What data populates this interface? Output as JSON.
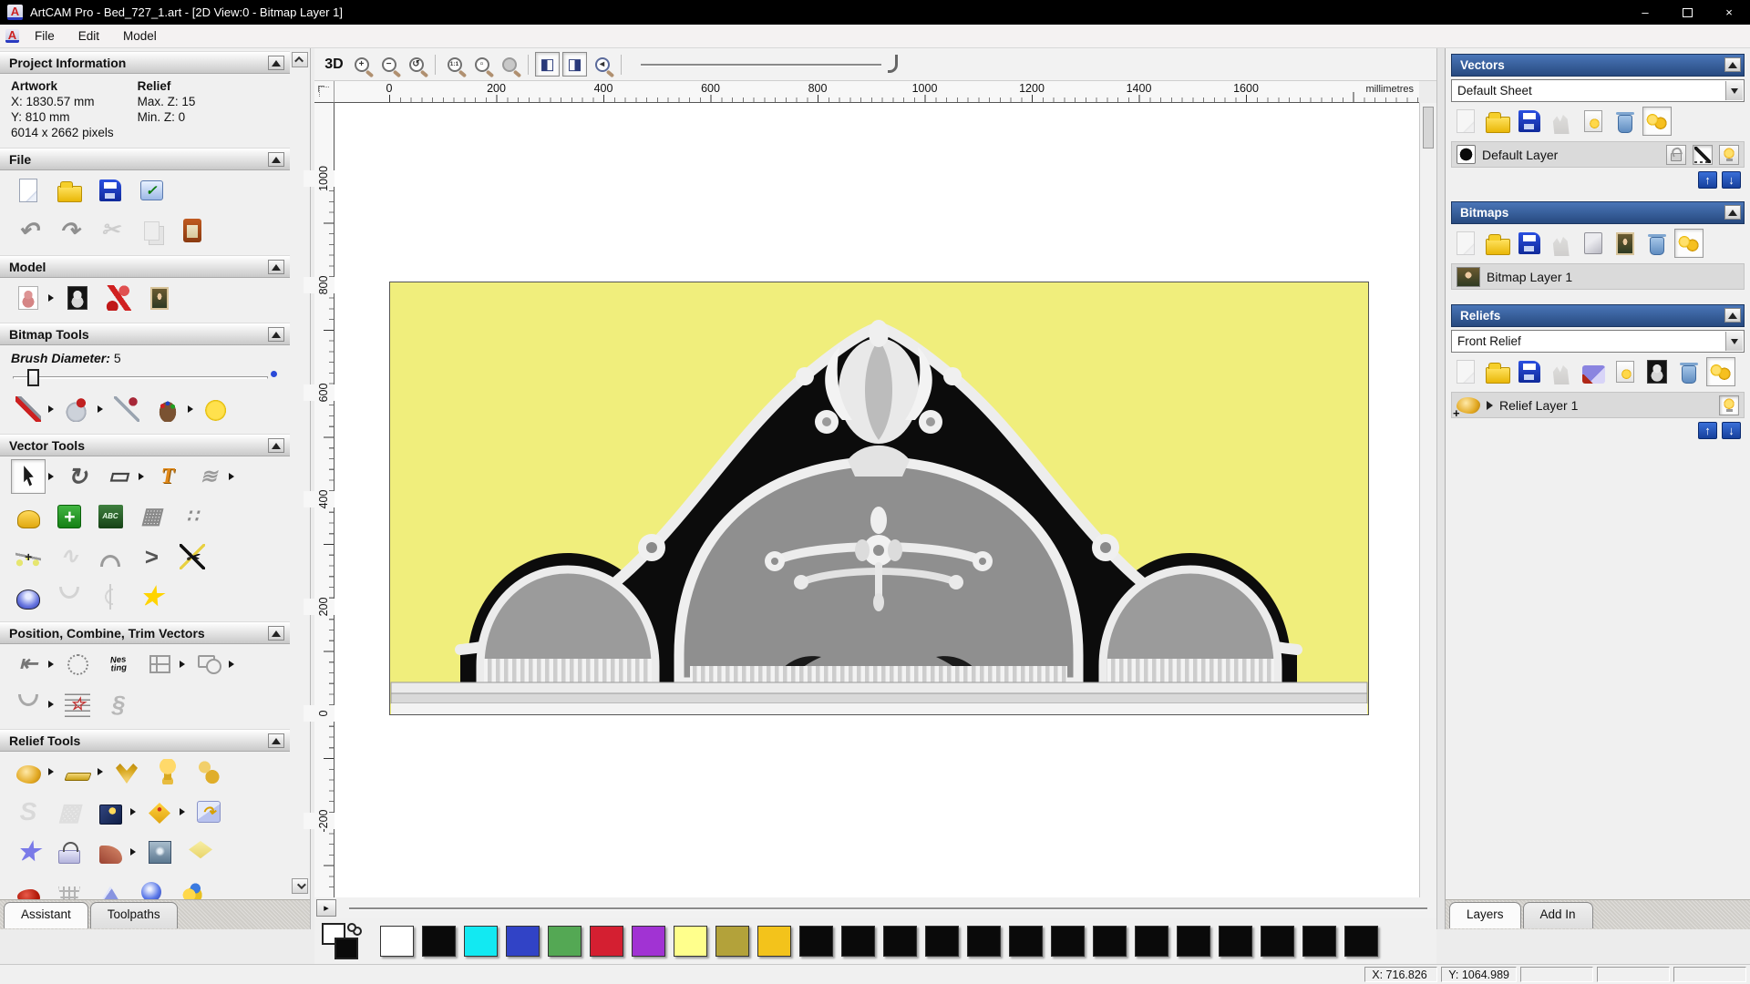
{
  "window": {
    "title": "ArtCAM Pro - Bed_727_1.art - [2D View:0 - Bitmap Layer 1]",
    "minimize": "–",
    "close": "×"
  },
  "menus": [
    "File",
    "Edit",
    "Model"
  ],
  "assistant": {
    "project": {
      "title": "Project Information",
      "artwork": "Artwork",
      "relief": "Relief",
      "x": "X: 1830.57 mm",
      "y": "Y: 810 mm",
      "pixels": "6014 x 2662 pixels",
      "maxz": "Max. Z: 15",
      "minz": "Min. Z: 0"
    },
    "file_title": "File",
    "model_title": "Model",
    "bitmap_title": "Bitmap Tools",
    "vector_title": "Vector Tools",
    "position_title": "Position, Combine, Trim Vectors",
    "relief_title": "Relief Tools",
    "brush_label": "Brush Diameter:",
    "brush_value": "5",
    "tabs": [
      {
        "label": "Assistant"
      },
      {
        "label": "Toolpaths"
      }
    ]
  },
  "toolsets": {
    "file1": [
      {
        "n": "new-model",
        "k": "page"
      },
      {
        "n": "open-model",
        "k": "folder"
      },
      {
        "n": "save-model",
        "k": "floppy"
      },
      {
        "n": "model-options",
        "k": "screen",
        "g": "✓"
      }
    ],
    "file2": [
      {
        "n": "undo",
        "g": "↶",
        "c": "#8f8f8f",
        "fs": 26
      },
      {
        "n": "redo",
        "g": "↷",
        "c": "#8f8f8f",
        "fs": 26
      },
      {
        "n": "cut",
        "g": "✂",
        "c": "#9a9a9a",
        "fs": 24,
        "dis": 1
      },
      {
        "n": "copy",
        "k": "copy",
        "dis": 1
      },
      {
        "n": "paste",
        "k": "clip"
      }
    ],
    "model": [
      {
        "n": "set-model-size",
        "k": "teddy",
        "fly": 1
      },
      {
        "n": "greyscale-model",
        "k": "teddyd"
      },
      {
        "n": "model-lighting",
        "k": "lamp"
      },
      {
        "n": "load-bitmap-image",
        "k": "mona"
      }
    ],
    "bitmap": [
      {
        "n": "paint-bitmap",
        "k": "brush",
        "fly": 1
      },
      {
        "n": "flood-fill",
        "k": "bucket",
        "fly": 1
      },
      {
        "n": "pick-colour",
        "k": "dropper"
      },
      {
        "n": "colour-palette",
        "k": "palette",
        "fly": 1
      },
      {
        "n": "texture-paint",
        "k": "blob"
      }
    ],
    "vector1": [
      {
        "n": "select-vectors",
        "k": "cursor",
        "act": 1,
        "fly": 1
      },
      {
        "n": "transform-vectors",
        "g": "↻",
        "c": "#555",
        "fs": 26
      },
      {
        "n": "create-rectangle",
        "g": "▭",
        "c": "#444",
        "fs": 24,
        "fly": 1
      },
      {
        "n": "create-text",
        "k": "textT",
        "g": "T"
      },
      {
        "n": "envelope-distortion",
        "g": "≋",
        "c": "#9a9a9a",
        "fs": 22,
        "fly": 1
      }
    ],
    "vector2": [
      {
        "n": "measure-tool",
        "k": "measure"
      },
      {
        "n": "add-vector-node",
        "k": "cross",
        "g": "+"
      },
      {
        "n": "text-block",
        "k": "abc",
        "g": "ABC"
      },
      {
        "n": "envelope-mesh",
        "g": "▦",
        "c": "#8a8a8a",
        "fs": 24
      },
      {
        "n": "paste-along-curve",
        "g": "∷",
        "c": "#8a8a8a",
        "fs": 20
      }
    ],
    "vector3": [
      {
        "n": "node-editing",
        "k": "poly",
        "g": "+"
      },
      {
        "n": "freehand-sketch",
        "g": "∿",
        "c": "#b0b0b0",
        "fs": 24,
        "dis": 1
      },
      {
        "n": "fit-arcs-to-vector",
        "k": "arc"
      },
      {
        "n": "offset-vector",
        "g": ">",
        "c": "#555",
        "fs": 26
      },
      {
        "n": "trim-vectors",
        "k": "trim",
        "g": "✂"
      }
    ],
    "vector4": [
      {
        "n": "create-dome",
        "k": "dome"
      },
      {
        "n": "join-vectors-with-curve",
        "k": "join",
        "dis": 1
      },
      {
        "n": "mirror-vectors",
        "k": "mirror",
        "dis": 1
      },
      {
        "n": "create-star",
        "g": "★",
        "c": "#ffd400",
        "fs": 28
      }
    ],
    "pos1": [
      {
        "n": "align-vectors",
        "g": "⇤",
        "c": "#777",
        "fs": 24,
        "fly": 1
      },
      {
        "n": "text-on-curve",
        "k": "tcurve"
      },
      {
        "n": "nesting",
        "k": "nesting",
        "g": "Nes\nting"
      },
      {
        "n": "block-paste",
        "k": "block",
        "fly": 1
      },
      {
        "n": "weld-vectors",
        "k": "weld",
        "fly": 1
      }
    ],
    "pos2": [
      {
        "n": "join-open-vectors",
        "k": "join",
        "fly": 1
      },
      {
        "n": "distort-vectors",
        "k": "distort",
        "g": "☆"
      },
      {
        "n": "interlock-vectors",
        "g": "§",
        "c": "#b8b8b8",
        "fs": 26
      }
    ],
    "relief1": [
      {
        "n": "sculpt-relief",
        "k": "clay",
        "fly": 1
      },
      {
        "n": "zero-plane-relief",
        "k": "bar",
        "fly": 1
      },
      {
        "n": "swept-profiles",
        "k": "fan"
      },
      {
        "n": "two-rail-sweep",
        "k": "mushroom"
      },
      {
        "n": "copy-relief",
        "k": "copygold"
      }
    ],
    "relief2": [
      {
        "n": "iso-form-letters",
        "g": "S",
        "c": "#b8b8b8",
        "fs": 28,
        "dis": 1
      },
      {
        "n": "weave-wizard",
        "g": "▩",
        "c": "#c4c4c4",
        "fs": 26,
        "dis": 1
      },
      {
        "n": "texture-relief",
        "k": "book",
        "fly": 1
      },
      {
        "n": "offset-relief",
        "k": "offset",
        "fly": 1
      },
      {
        "n": "copy-transform-relief",
        "k": "copytr",
        "g": "↷"
      }
    ],
    "relief3": [
      {
        "n": "star-wizard",
        "g": "★",
        "c": "#7a7ae8",
        "fs": 28
      },
      {
        "n": "constant-height-relief",
        "k": "clamp"
      },
      {
        "n": "turn-relief",
        "k": "fanslice",
        "fly": 1
      },
      {
        "n": "face-wizard",
        "k": "emboss"
      },
      {
        "n": "relief-layer-stack",
        "k": "layers"
      }
    ],
    "relief4": [
      {
        "n": "smooth-relief",
        "k": "redblob"
      },
      {
        "n": "basket-weave-wizard",
        "k": "basket"
      },
      {
        "n": "pyramid-relief",
        "k": "pyramid"
      },
      {
        "n": "sphere-ornament",
        "k": "sphere"
      },
      {
        "n": "splash-relief",
        "k": "splash"
      }
    ],
    "vec_tb": [
      {
        "n": "new-vector-sheet",
        "k": "page",
        "dis": 1
      },
      {
        "n": "open-vector-layers",
        "k": "folder"
      },
      {
        "n": "save-vector-layers",
        "k": "floppy"
      },
      {
        "n": "merge-vector-layers",
        "k": "merge",
        "dis": 1
      },
      {
        "n": "toggle-vector-visibility",
        "k": "bulbpage"
      },
      {
        "n": "delete-vector-layer",
        "k": "trash"
      },
      {
        "n": "show-all-vector-layers",
        "k": "bulbs",
        "act": 1
      }
    ],
    "bmp_tb": [
      {
        "n": "new-bitmap-layer",
        "k": "page",
        "dis": 1
      },
      {
        "n": "open-bitmap-layers",
        "k": "folder"
      },
      {
        "n": "save-bitmap-layers",
        "k": "floppy"
      },
      {
        "n": "merge-bitmap-layers",
        "k": "merge",
        "dis": 1
      },
      {
        "n": "blank-bitmap-layer",
        "k": "card"
      },
      {
        "n": "copy-bitmap-layer",
        "k": "mona"
      },
      {
        "n": "delete-bitmap-layer",
        "k": "trash"
      },
      {
        "n": "show-all-bitmap-layers",
        "k": "bulbs",
        "act": 1
      }
    ],
    "rel_tb": [
      {
        "n": "new-relief-layer",
        "k": "page",
        "dis": 1
      },
      {
        "n": "open-relief-layers",
        "k": "folder"
      },
      {
        "n": "save-relief-layers",
        "k": "floppy"
      },
      {
        "n": "merge-relief-layers",
        "k": "merge",
        "dis": 1
      },
      {
        "n": "stack-relief-layers",
        "k": "stack"
      },
      {
        "n": "toggle-relief-visibility",
        "k": "bulbpage"
      },
      {
        "n": "greyscale-from-relief",
        "k": "teddyd"
      },
      {
        "n": "delete-relief-layer",
        "k": "trash"
      },
      {
        "n": "show-all-relief-layers",
        "k": "bulbs",
        "act": 1
      }
    ]
  },
  "canvas": {
    "btn_3d": "3D",
    "ruler_h": [
      "0",
      "200",
      "400",
      "600",
      "800",
      "1000",
      "1200",
      "1400",
      "1600"
    ],
    "ruler_units": "millimetres",
    "ruler_v": [
      "1000",
      "800",
      "600",
      "400",
      "200",
      "0",
      "-200"
    ]
  },
  "panels": {
    "vectors": {
      "title": "Vectors",
      "sheet": "Default Sheet",
      "layer": "Default Layer"
    },
    "bitmaps": {
      "title": "Bitmaps",
      "layer": "Bitmap Layer 1"
    },
    "reliefs": {
      "title": "Reliefs",
      "relief": "Front Relief",
      "layer": "Relief Layer 1"
    },
    "tabs": [
      {
        "label": "Layers"
      },
      {
        "label": "Add In"
      }
    ]
  },
  "palette": {
    "colors": [
      "#ffffff",
      "#0a0a0a",
      "#12e9f2",
      "#3143c6",
      "#54a854",
      "#d41f31",
      "#a133d3",
      "#ffff8c",
      "#b3a23a",
      "#f3c31b",
      "#0a0a0a",
      "#0a0a0a",
      "#0a0a0a",
      "#0a0a0a",
      "#0a0a0a",
      "#0a0a0a",
      "#0a0a0a",
      "#0a0a0a",
      "#0a0a0a",
      "#0a0a0a",
      "#0a0a0a",
      "#0a0a0a",
      "#0a0a0a",
      "#0a0a0a"
    ]
  },
  "status": {
    "x": "X: 716.826",
    "y": "Y: 1064.989"
  }
}
